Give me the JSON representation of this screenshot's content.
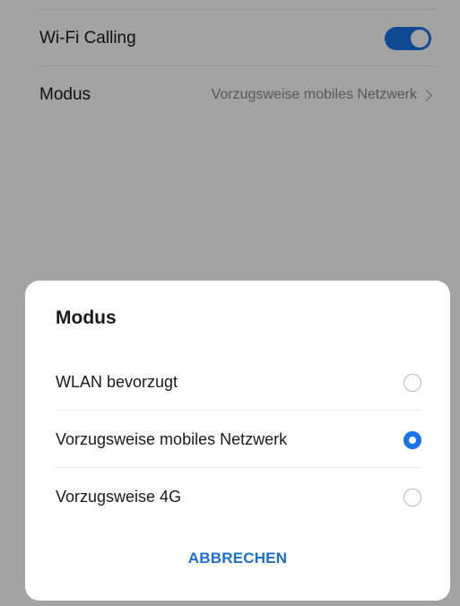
{
  "settings": {
    "wifi_calling": {
      "label": "Wi-Fi Calling",
      "enabled": true
    },
    "mode": {
      "label": "Modus",
      "value": "Vorzugsweise mobiles Netzwerk"
    }
  },
  "dialog": {
    "title": "Modus",
    "options": [
      {
        "label": "WLAN bevorzugt",
        "selected": false
      },
      {
        "label": "Vorzugsweise mobiles Netzwerk",
        "selected": true
      },
      {
        "label": "Vorzugsweise 4G",
        "selected": false
      }
    ],
    "cancel_label": "ABBRECHEN"
  },
  "colors": {
    "accent": "#1a73e8",
    "cancel_text": "#1a6fcf"
  }
}
